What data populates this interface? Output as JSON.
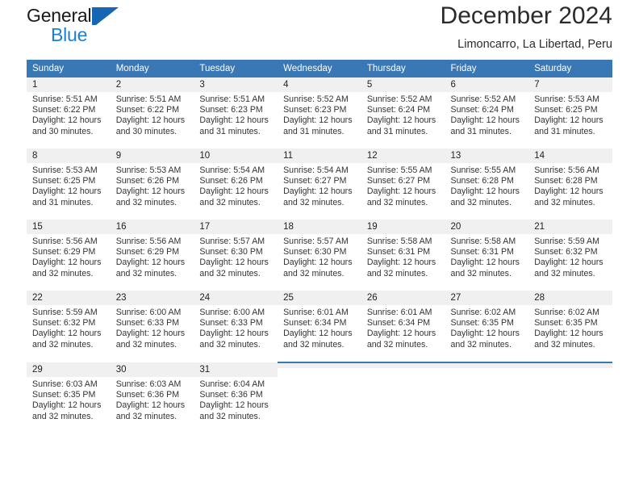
{
  "brand": {
    "line1": "General",
    "line2": "Blue",
    "flag_color": "#1567b3",
    "blue_text_color": "#1b7fd4"
  },
  "header": {
    "title": "December 2024",
    "subtitle": "Limoncarro, La Libertad, Peru"
  },
  "theme": {
    "header_blue": "#3a77b5",
    "daynum_gray": "#f0f0f0"
  },
  "weekdays": [
    "Sunday",
    "Monday",
    "Tuesday",
    "Wednesday",
    "Thursday",
    "Friday",
    "Saturday"
  ],
  "labels": {
    "sunrise_prefix": "Sunrise:",
    "sunset_prefix": "Sunset:",
    "daylight_prefix": "Daylight:"
  },
  "weeks": [
    [
      {
        "day": "1",
        "sunrise": "Sunrise: 5:51 AM",
        "sunset": "Sunset: 6:22 PM",
        "daylight1": "Daylight: 12 hours",
        "daylight2": "and 30 minutes."
      },
      {
        "day": "2",
        "sunrise": "Sunrise: 5:51 AM",
        "sunset": "Sunset: 6:22 PM",
        "daylight1": "Daylight: 12 hours",
        "daylight2": "and 30 minutes."
      },
      {
        "day": "3",
        "sunrise": "Sunrise: 5:51 AM",
        "sunset": "Sunset: 6:23 PM",
        "daylight1": "Daylight: 12 hours",
        "daylight2": "and 31 minutes."
      },
      {
        "day": "4",
        "sunrise": "Sunrise: 5:52 AM",
        "sunset": "Sunset: 6:23 PM",
        "daylight1": "Daylight: 12 hours",
        "daylight2": "and 31 minutes."
      },
      {
        "day": "5",
        "sunrise": "Sunrise: 5:52 AM",
        "sunset": "Sunset: 6:24 PM",
        "daylight1": "Daylight: 12 hours",
        "daylight2": "and 31 minutes."
      },
      {
        "day": "6",
        "sunrise": "Sunrise: 5:52 AM",
        "sunset": "Sunset: 6:24 PM",
        "daylight1": "Daylight: 12 hours",
        "daylight2": "and 31 minutes."
      },
      {
        "day": "7",
        "sunrise": "Sunrise: 5:53 AM",
        "sunset": "Sunset: 6:25 PM",
        "daylight1": "Daylight: 12 hours",
        "daylight2": "and 31 minutes."
      }
    ],
    [
      {
        "day": "8",
        "sunrise": "Sunrise: 5:53 AM",
        "sunset": "Sunset: 6:25 PM",
        "daylight1": "Daylight: 12 hours",
        "daylight2": "and 31 minutes."
      },
      {
        "day": "9",
        "sunrise": "Sunrise: 5:53 AM",
        "sunset": "Sunset: 6:26 PM",
        "daylight1": "Daylight: 12 hours",
        "daylight2": "and 32 minutes."
      },
      {
        "day": "10",
        "sunrise": "Sunrise: 5:54 AM",
        "sunset": "Sunset: 6:26 PM",
        "daylight1": "Daylight: 12 hours",
        "daylight2": "and 32 minutes."
      },
      {
        "day": "11",
        "sunrise": "Sunrise: 5:54 AM",
        "sunset": "Sunset: 6:27 PM",
        "daylight1": "Daylight: 12 hours",
        "daylight2": "and 32 minutes."
      },
      {
        "day": "12",
        "sunrise": "Sunrise: 5:55 AM",
        "sunset": "Sunset: 6:27 PM",
        "daylight1": "Daylight: 12 hours",
        "daylight2": "and 32 minutes."
      },
      {
        "day": "13",
        "sunrise": "Sunrise: 5:55 AM",
        "sunset": "Sunset: 6:28 PM",
        "daylight1": "Daylight: 12 hours",
        "daylight2": "and 32 minutes."
      },
      {
        "day": "14",
        "sunrise": "Sunrise: 5:56 AM",
        "sunset": "Sunset: 6:28 PM",
        "daylight1": "Daylight: 12 hours",
        "daylight2": "and 32 minutes."
      }
    ],
    [
      {
        "day": "15",
        "sunrise": "Sunrise: 5:56 AM",
        "sunset": "Sunset: 6:29 PM",
        "daylight1": "Daylight: 12 hours",
        "daylight2": "and 32 minutes."
      },
      {
        "day": "16",
        "sunrise": "Sunrise: 5:56 AM",
        "sunset": "Sunset: 6:29 PM",
        "daylight1": "Daylight: 12 hours",
        "daylight2": "and 32 minutes."
      },
      {
        "day": "17",
        "sunrise": "Sunrise: 5:57 AM",
        "sunset": "Sunset: 6:30 PM",
        "daylight1": "Daylight: 12 hours",
        "daylight2": "and 32 minutes."
      },
      {
        "day": "18",
        "sunrise": "Sunrise: 5:57 AM",
        "sunset": "Sunset: 6:30 PM",
        "daylight1": "Daylight: 12 hours",
        "daylight2": "and 32 minutes."
      },
      {
        "day": "19",
        "sunrise": "Sunrise: 5:58 AM",
        "sunset": "Sunset: 6:31 PM",
        "daylight1": "Daylight: 12 hours",
        "daylight2": "and 32 minutes."
      },
      {
        "day": "20",
        "sunrise": "Sunrise: 5:58 AM",
        "sunset": "Sunset: 6:31 PM",
        "daylight1": "Daylight: 12 hours",
        "daylight2": "and 32 minutes."
      },
      {
        "day": "21",
        "sunrise": "Sunrise: 5:59 AM",
        "sunset": "Sunset: 6:32 PM",
        "daylight1": "Daylight: 12 hours",
        "daylight2": "and 32 minutes."
      }
    ],
    [
      {
        "day": "22",
        "sunrise": "Sunrise: 5:59 AM",
        "sunset": "Sunset: 6:32 PM",
        "daylight1": "Daylight: 12 hours",
        "daylight2": "and 32 minutes."
      },
      {
        "day": "23",
        "sunrise": "Sunrise: 6:00 AM",
        "sunset": "Sunset: 6:33 PM",
        "daylight1": "Daylight: 12 hours",
        "daylight2": "and 32 minutes."
      },
      {
        "day": "24",
        "sunrise": "Sunrise: 6:00 AM",
        "sunset": "Sunset: 6:33 PM",
        "daylight1": "Daylight: 12 hours",
        "daylight2": "and 32 minutes."
      },
      {
        "day": "25",
        "sunrise": "Sunrise: 6:01 AM",
        "sunset": "Sunset: 6:34 PM",
        "daylight1": "Daylight: 12 hours",
        "daylight2": "and 32 minutes."
      },
      {
        "day": "26",
        "sunrise": "Sunrise: 6:01 AM",
        "sunset": "Sunset: 6:34 PM",
        "daylight1": "Daylight: 12 hours",
        "daylight2": "and 32 minutes."
      },
      {
        "day": "27",
        "sunrise": "Sunrise: 6:02 AM",
        "sunset": "Sunset: 6:35 PM",
        "daylight1": "Daylight: 12 hours",
        "daylight2": "and 32 minutes."
      },
      {
        "day": "28",
        "sunrise": "Sunrise: 6:02 AM",
        "sunset": "Sunset: 6:35 PM",
        "daylight1": "Daylight: 12 hours",
        "daylight2": "and 32 minutes."
      }
    ],
    [
      {
        "day": "29",
        "sunrise": "Sunrise: 6:03 AM",
        "sunset": "Sunset: 6:35 PM",
        "daylight1": "Daylight: 12 hours",
        "daylight2": "and 32 minutes."
      },
      {
        "day": "30",
        "sunrise": "Sunrise: 6:03 AM",
        "sunset": "Sunset: 6:36 PM",
        "daylight1": "Daylight: 12 hours",
        "daylight2": "and 32 minutes."
      },
      {
        "day": "31",
        "sunrise": "Sunrise: 6:04 AM",
        "sunset": "Sunset: 6:36 PM",
        "daylight1": "Daylight: 12 hours",
        "daylight2": "and 32 minutes."
      },
      {
        "day": "",
        "sunrise": "",
        "sunset": "",
        "daylight1": "",
        "daylight2": "",
        "empty": true
      },
      {
        "day": "",
        "sunrise": "",
        "sunset": "",
        "daylight1": "",
        "daylight2": "",
        "empty": true
      },
      {
        "day": "",
        "sunrise": "",
        "sunset": "",
        "daylight1": "",
        "daylight2": "",
        "empty": true
      },
      {
        "day": "",
        "sunrise": "",
        "sunset": "",
        "daylight1": "",
        "daylight2": "",
        "empty": true
      }
    ]
  ]
}
